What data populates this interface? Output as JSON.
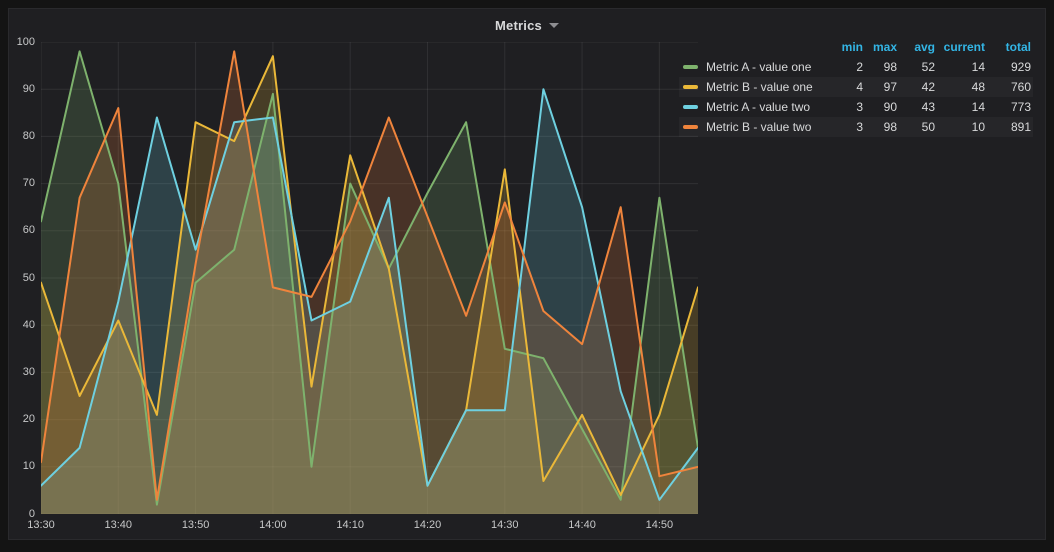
{
  "panel": {
    "title": "Metrics"
  },
  "colors": {
    "background": "#141414",
    "panel": "#1f1f22",
    "grid": "rgba(255,255,255,0.08)",
    "axis_text": "#c7c8c9",
    "text": "#d8d9da",
    "legend_header": "#33b5e5"
  },
  "legend": {
    "columns": [
      "min",
      "max",
      "avg",
      "current",
      "total"
    ],
    "rows": [
      {
        "label": "Metric A - value one",
        "color": "#7EB26D",
        "min": "2",
        "max": "98",
        "avg": "52",
        "current": "14",
        "total": "929"
      },
      {
        "label": "Metric B - value one",
        "color": "#EAB839",
        "min": "4",
        "max": "97",
        "avg": "42",
        "current": "48",
        "total": "760"
      },
      {
        "label": "Metric A - value two",
        "color": "#6ED0E0",
        "min": "3",
        "max": "90",
        "avg": "43",
        "current": "14",
        "total": "773"
      },
      {
        "label": "Metric B - value two",
        "color": "#EF843C",
        "min": "3",
        "max": "98",
        "avg": "50",
        "current": "10",
        "total": "891"
      }
    ]
  },
  "chart_data": {
    "type": "line",
    "title": "Metrics",
    "x": [
      "13:30",
      "13:35",
      "13:40",
      "13:45",
      "13:50",
      "13:55",
      "14:00",
      "14:05",
      "14:10",
      "14:15",
      "14:20",
      "14:25",
      "14:30",
      "14:35",
      "14:40",
      "14:45",
      "14:50",
      "14:55"
    ],
    "x_tick_labels": [
      "13:30",
      "13:40",
      "13:50",
      "14:00",
      "14:10",
      "14:20",
      "14:30",
      "14:40",
      "14:50"
    ],
    "y_tick_labels": [
      "0",
      "10",
      "20",
      "30",
      "40",
      "50",
      "60",
      "70",
      "80",
      "90",
      "100"
    ],
    "ylim": [
      0,
      100
    ],
    "grid": true,
    "fill_opacity": 0.2,
    "line_width": 2,
    "legend_position": "right-table",
    "series": [
      {
        "name": "Metric A - value one",
        "color": "#7EB26D",
        "values": [
          62,
          98,
          70,
          2,
          49,
          56,
          89,
          10,
          70,
          52,
          68,
          83,
          35,
          33,
          18,
          3,
          67,
          14
        ]
      },
      {
        "name": "Metric B - value one",
        "color": "#EAB839",
        "values": [
          49,
          25,
          41,
          21,
          83,
          79,
          97,
          27,
          76,
          52,
          6,
          22,
          73,
          7,
          21,
          4,
          21,
          48
        ]
      },
      {
        "name": "Metric A - value two",
        "color": "#6ED0E0",
        "values": [
          6,
          14,
          45,
          84,
          56,
          83,
          84,
          41,
          45,
          67,
          6,
          22,
          22,
          90,
          65,
          26,
          3,
          14
        ]
      },
      {
        "name": "Metric B - value two",
        "color": "#EF843C",
        "values": [
          11,
          67,
          86,
          3,
          53,
          98,
          48,
          46,
          62,
          84,
          63,
          42,
          66,
          43,
          36,
          65,
          8,
          10
        ]
      }
    ]
  }
}
